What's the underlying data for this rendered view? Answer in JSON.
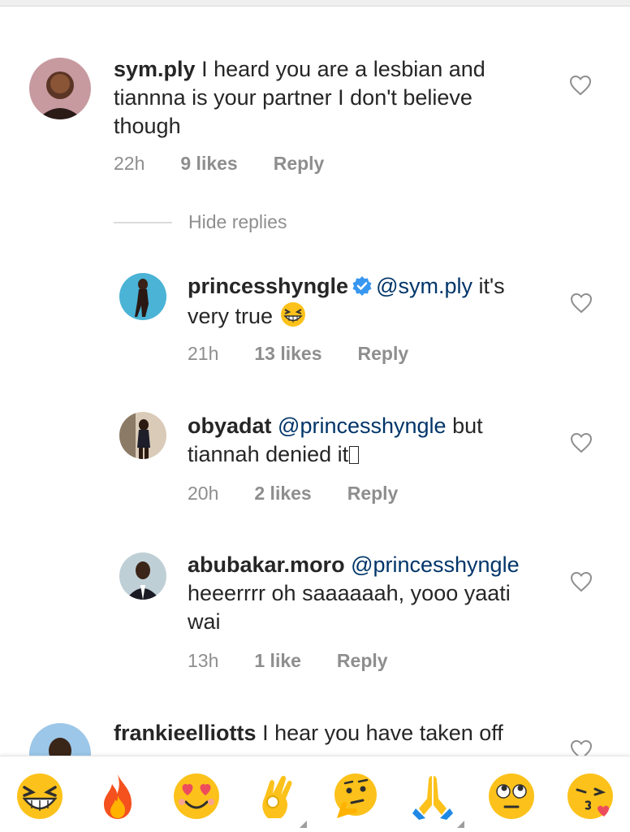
{
  "comments": [
    {
      "username": "sym.ply",
      "text_before": " I heard you are a lesbian and",
      "text_line2": "tiannna is your partner I don't believe",
      "text_line3": "though",
      "time": "22h",
      "likes": "9 likes",
      "reply": "Reply"
    },
    {
      "username": "princesshyngle",
      "mention": "@sym.ply",
      "text_after": " it's",
      "text_line2": "very true",
      "time": "21h",
      "likes": "13 likes",
      "reply": "Reply"
    },
    {
      "username": "obyadat",
      "mention": "@princesshyngle",
      "text_after": " but",
      "text_line2": "tiannah denied it",
      "time": "20h",
      "likes": "2 likes",
      "reply": "Reply"
    },
    {
      "username": "abubakar.moro",
      "mention": "@princesshyngle",
      "text_line2": "heeerrrr oh saaaaaah, yooo yaati",
      "text_line3": "wai",
      "time": "13h",
      "likes": "1 like",
      "reply": "Reply"
    },
    {
      "username": "frankieelliotts",
      "text_before": " I hear you have taken off"
    }
  ],
  "hide_replies": "Hide replies",
  "emoji_bar": [
    "grinning-squinting-face",
    "fire",
    "heart-eyes",
    "ok-hand",
    "thinking-face",
    "folded-hands",
    "rolling-eyes",
    "face-blowing-kiss"
  ],
  "colors": {
    "mention": "#003569",
    "meta": "#8e8e8e",
    "verified": "#3897f0"
  }
}
